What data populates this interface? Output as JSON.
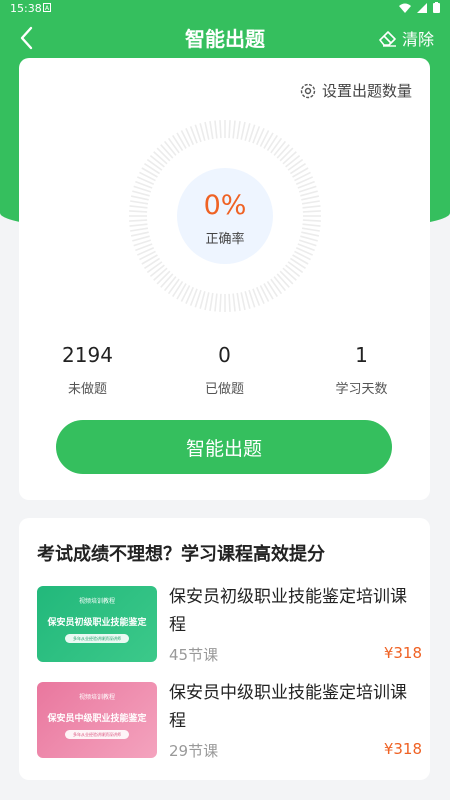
{
  "status_bar": {
    "time": "15:38",
    "notification_icon": "A"
  },
  "header": {
    "title": "智能出题",
    "clear_label": "清除",
    "back_icon": "chevron-left",
    "clear_icon": "eraser"
  },
  "quiz": {
    "settings_label": "设置出题数量",
    "accuracy_value": "0%",
    "accuracy_label": "正确率",
    "accuracy_fraction": 0,
    "stats": [
      {
        "value": "2194",
        "label": "未做题"
      },
      {
        "value": "0",
        "label": "已做题"
      },
      {
        "value": "1",
        "label": "学习天数"
      }
    ],
    "cta_label": "智能出题"
  },
  "courses": {
    "heading": "考试成绩不理想？学习课程高效提分",
    "items": [
      {
        "thumb_top": "视频培训教程",
        "thumb_title": "保安员初级职业技能鉴定",
        "thumb_sub": "多年从业经验讲课资深讲师",
        "title": "保安员初级职业技能鉴定培训课程",
        "lessons": "45节课",
        "price": "¥318"
      },
      {
        "thumb_top": "视频培训教程",
        "thumb_title": "保安员中级职业技能鉴定",
        "thumb_sub": "多年从业经验讲课资深讲师",
        "title": "保安员中级职业技能鉴定培训课程",
        "lessons": "29节课",
        "price": "¥318"
      }
    ]
  },
  "colors": {
    "brand": "#35bf5e",
    "accent": "#ef6224"
  }
}
